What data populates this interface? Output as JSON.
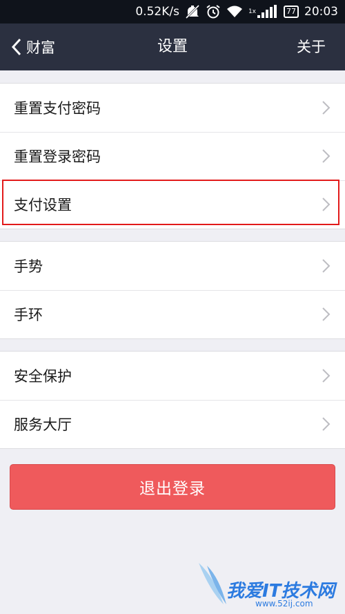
{
  "status_bar": {
    "speed": "0.52K/s",
    "sim_label": "1x",
    "battery": "77",
    "time": "20:03"
  },
  "nav": {
    "back_label": "财富",
    "title": "设置",
    "about_label": "关于"
  },
  "groups": [
    {
      "items": [
        {
          "label": "重置支付密码"
        },
        {
          "label": "重置登录密码"
        },
        {
          "label": "支付设置"
        }
      ]
    },
    {
      "items": [
        {
          "label": "手势"
        },
        {
          "label": "手环"
        }
      ]
    },
    {
      "items": [
        {
          "label": "安全保护"
        },
        {
          "label": "服务大厅"
        }
      ]
    }
  ],
  "logout_label": "退出登录",
  "watermark": {
    "text": "我爱IT技术网",
    "url": "www.52ij.com"
  },
  "colors": {
    "status_bar_bg": "#0f131b",
    "nav_bg": "#2b3040",
    "page_bg": "#efeff4",
    "logout_bg": "#ef5a5c",
    "highlight": "#e21a1a"
  }
}
